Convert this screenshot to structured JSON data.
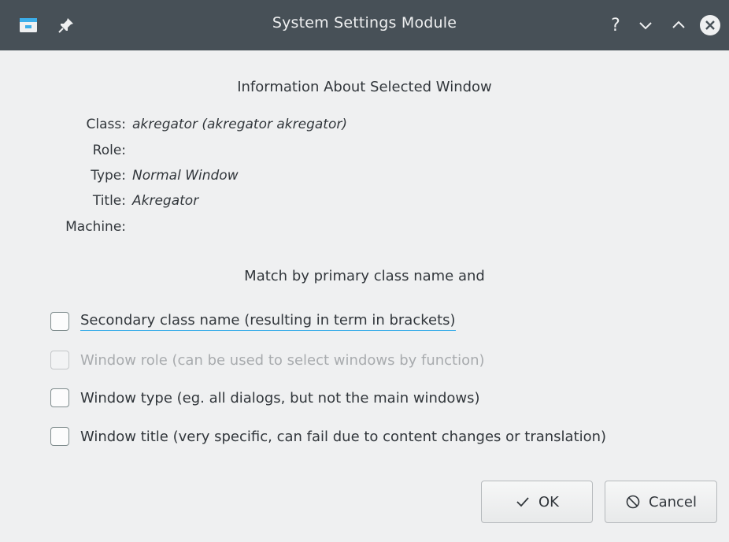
{
  "titlebar": {
    "title": "System Settings Module",
    "icons": {
      "app": "app-window-icon",
      "pin": "pin-icon",
      "help": "help-icon",
      "minimize": "minimize-icon",
      "maximize": "maximize-icon",
      "close": "close-icon"
    },
    "help_glyph": "?"
  },
  "info": {
    "heading": "Information About Selected Window",
    "rows": [
      {
        "label": "Class:",
        "value": "akregator (akregator akregator)"
      },
      {
        "label": "Role:",
        "value": ""
      },
      {
        "label": "Type:",
        "value": "Normal Window"
      },
      {
        "label": "Title:",
        "value": "Akregator"
      },
      {
        "label": "Machine:",
        "value": ""
      }
    ]
  },
  "match": {
    "heading": "Match by primary class name and",
    "options": [
      {
        "label": "Secondary class name  (resulting in term in brackets)",
        "checked": false,
        "enabled": true,
        "focused": true
      },
      {
        "label": "Window role (can be used to select windows by function)",
        "checked": false,
        "enabled": false,
        "focused": false
      },
      {
        "label": "Window type (eg. all dialogs, but not the main windows)",
        "checked": false,
        "enabled": true,
        "focused": false
      },
      {
        "label": "Window title (very specific, can fail due to content changes or translation)",
        "checked": false,
        "enabled": true,
        "focused": false
      }
    ]
  },
  "buttons": {
    "ok": "OK",
    "cancel": "Cancel"
  },
  "colors": {
    "titlebar": "#475057",
    "background": "#eff0f1",
    "focus_accent": "#3daee9",
    "close_button": "#eff0f1"
  }
}
